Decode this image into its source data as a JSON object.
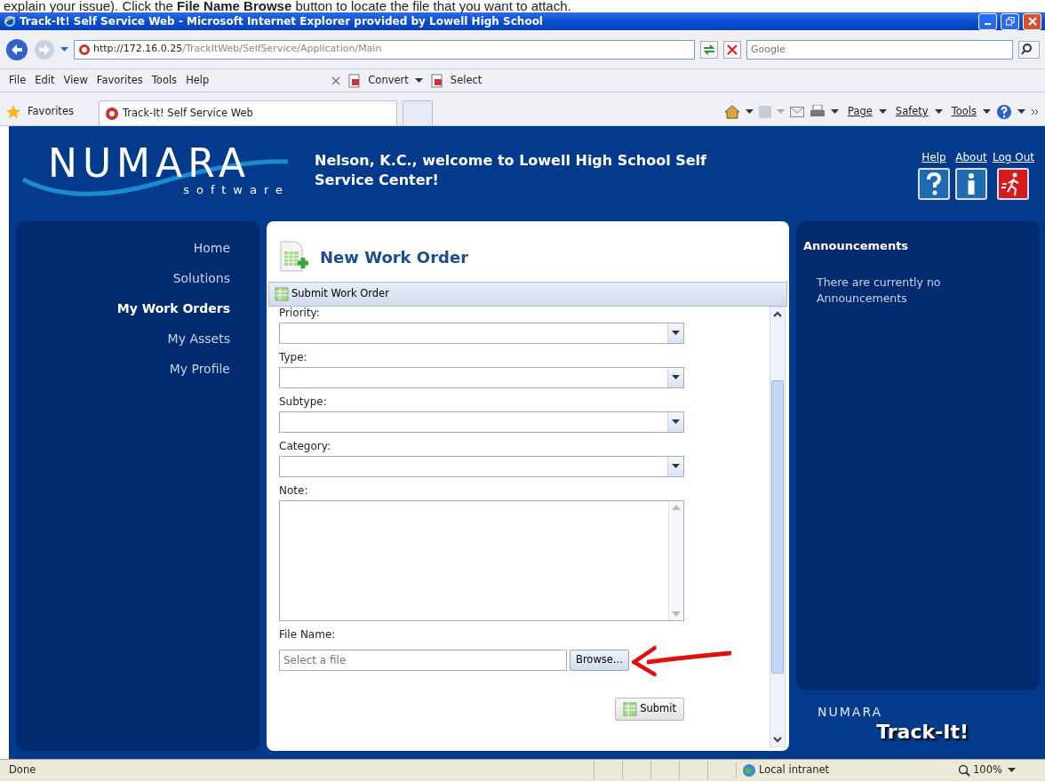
{
  "document_text": "explain your issue). Click the **File Name Browse** button to locate the file that you want to attach.",
  "window": {
    "title": "Track-It! Self Service Web - Microsoft Internet Explorer provided by Lowell High School"
  },
  "address_bar": {
    "url_host": "http://172.16.0.25",
    "url_path": "/TrackItWeb/SelfService/Application/Main",
    "search_placeholder": "Google"
  },
  "menu": [
    "File",
    "Edit",
    "View",
    "Favorites",
    "Tools",
    "Help"
  ],
  "toolbar": [
    {
      "label": "Convert",
      "kind": "dropdown"
    },
    {
      "label": "Select",
      "kind": "plain"
    }
  ],
  "favorites_bar": {
    "label": "Favorites",
    "tabs": [
      {
        "label": "Track-It! Self Service Web",
        "selected": true
      },
      {
        "selected": false
      }
    ],
    "commands": [
      "Page",
      "Safety",
      "Tools"
    ]
  },
  "header": {
    "logo": "NUMARA",
    "logo_sub": "software",
    "welcome": "Nelson, K.C., welcome to Lowell High School Self Service Center!",
    "links": [
      {
        "label": "Help",
        "kind": "help"
      },
      {
        "label": "About",
        "kind": "about"
      },
      {
        "label": "Log Out",
        "kind": "logout"
      }
    ]
  },
  "nav": [
    {
      "label": "Home",
      "selected": false
    },
    {
      "label": "Solutions",
      "selected": false
    },
    {
      "label": "My Work Orders",
      "selected": true
    },
    {
      "label": "My Assets",
      "selected": false
    },
    {
      "label": "My Profile",
      "selected": false
    }
  ],
  "form": {
    "title": "New Work Order",
    "toolbar_button": "Submit Work Order",
    "fields": [
      {
        "label": "Priority:",
        "kind": "select"
      },
      {
        "label": "Type:",
        "kind": "select"
      },
      {
        "label": "Subtype:",
        "kind": "select"
      },
      {
        "label": "Category:",
        "kind": "select"
      },
      {
        "label": "Note:",
        "kind": "textarea"
      },
      {
        "label": "File Name:",
        "kind": "file",
        "placeholder": "Select a file",
        "button": "Browse..."
      }
    ],
    "submit": "Submit"
  },
  "announcements": {
    "title": "Announcements",
    "text": "There are currently no Announcements"
  },
  "footer_logo": {
    "brand": "NUMARA",
    "product": "Track-It!"
  },
  "status_bar": {
    "status": "Done",
    "zone": "Local intranet",
    "zoom": "100%"
  }
}
